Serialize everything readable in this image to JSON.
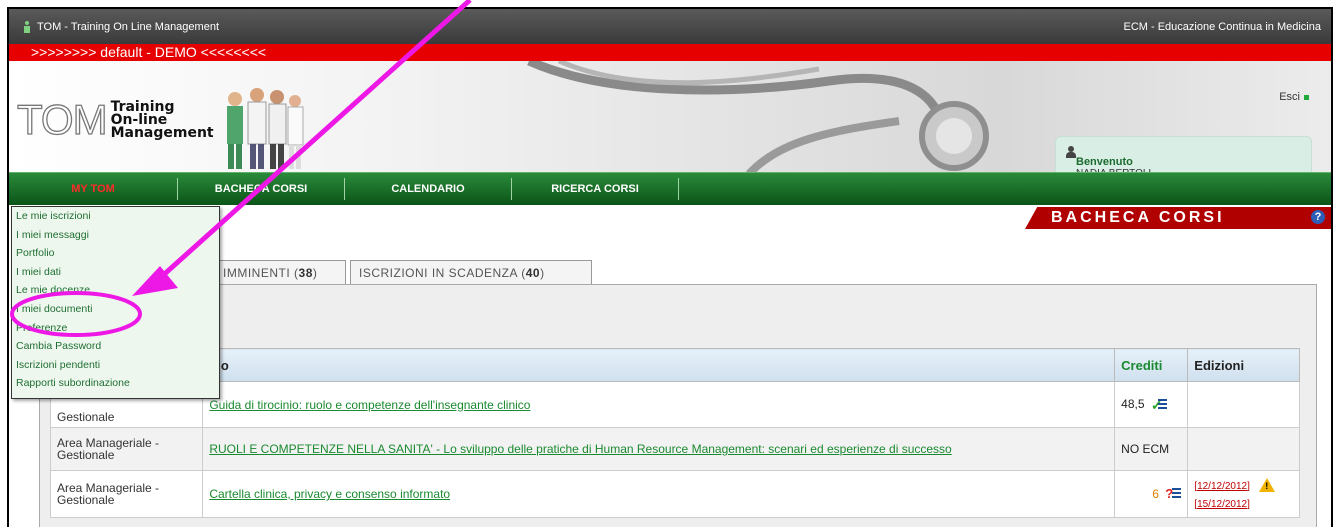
{
  "app": {
    "title": "TOM - Training On Line Management",
    "right_title": "ECM - Educazione Continua in Medicina",
    "demo_banner": ">>>>>>>> default - DEMO <<<<<<<<"
  },
  "logo": {
    "big": "TOM",
    "line1": "Training",
    "line2": "On-line",
    "line3": "Management"
  },
  "header": {
    "logout": "Esci",
    "welcome_title": "Benvenuto",
    "user_name": "NADIA BERTOLI"
  },
  "nav": {
    "items": [
      "MY TOM",
      "BACHECA CORSI",
      "CALENDARIO",
      "RICERCA CORSI"
    ]
  },
  "page": {
    "section_title": "BACHECA CORSI",
    "help": "?"
  },
  "tabs": [
    {
      "label": "IMMINENTI",
      "count": "38"
    },
    {
      "label": "ISCRIZIONI IN SCADENZA",
      "count": "40"
    }
  ],
  "dropdown": {
    "items": [
      "Le mie iscrizioni",
      "I miei messaggi",
      "Portfolio",
      "I miei dati",
      "Le mie docenze",
      "I miei documenti",
      "Preferenze",
      "Cambia Password",
      "Iscrizioni pendenti",
      "Rapporti subordinazione"
    ]
  },
  "table": {
    "headers": [
      "",
      "olo",
      "Crediti",
      "Edizioni"
    ],
    "rows": [
      {
        "area": "Gestionale",
        "title": "Guida di tirocinio: ruolo e competenze dell'insegnante clinico",
        "credits": "48,5",
        "editions": []
      },
      {
        "area": "Area Manageriale - Gestionale",
        "title": "RUOLI E COMPETENZE NELLA SANITA' - Lo sviluppo delle pratiche di Human Resource Management: scenari ed esperienze di successo",
        "credits": "NO ECM",
        "editions": []
      },
      {
        "area": "Area Manageriale - Gestionale",
        "title": "Cartella clinica, privacy e consenso informato",
        "credits": "6",
        "editions": [
          "12/12/2012",
          "15/12/2012"
        ]
      }
    ]
  },
  "colors": {
    "accent_green": "#1a8a30",
    "nav_green": "#0b5418",
    "brand_red": "#e60000",
    "annotation_magenta": "#ee18e6"
  }
}
